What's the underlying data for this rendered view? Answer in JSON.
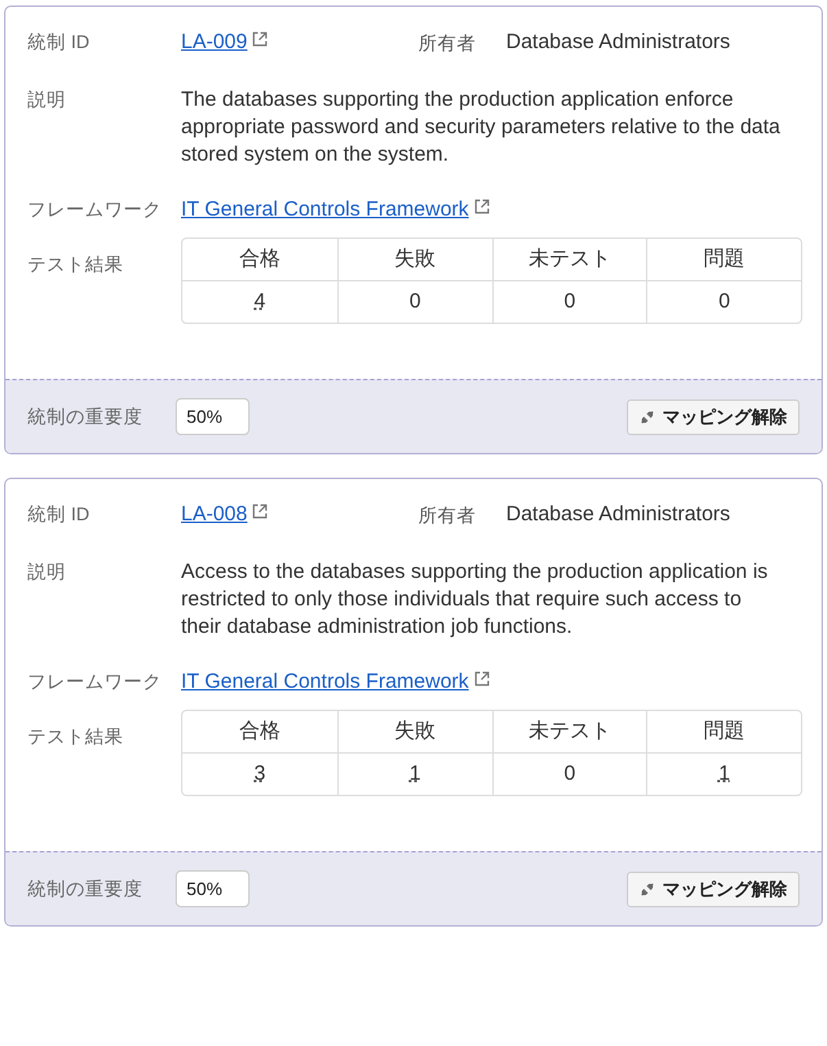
{
  "cards": [
    {
      "id_label": "統制 ID",
      "id": "LA-009",
      "owner_label": "所有者",
      "owner": "Database Administrators",
      "desc_label": "説明",
      "description": "The databases supporting the production application enforce appropriate password and security parameters relative to the data stored system on the system.",
      "framework_label": "フレームワーク",
      "framework": "IT General Controls Framework",
      "results_label": "テスト結果",
      "results": [
        {
          "header": "合格",
          "value": "4",
          "link": true
        },
        {
          "header": "失敗",
          "value": "0",
          "link": false
        },
        {
          "header": "未テスト",
          "value": "0",
          "link": false
        },
        {
          "header": "問題",
          "value": "0",
          "link": false
        }
      ],
      "importance_label": "統制の重要度",
      "importance": "50%",
      "unmap_button": "マッピング解除"
    },
    {
      "id_label": "統制 ID",
      "id": "LA-008",
      "owner_label": "所有者",
      "owner": "Database Administrators",
      "desc_label": "説明",
      "description": "Access to the databases supporting the production application is restricted to only those individuals that require such access to their database administration job functions.",
      "framework_label": "フレームワーク",
      "framework": "IT General Controls Framework",
      "results_label": "テスト結果",
      "results": [
        {
          "header": "合格",
          "value": "3",
          "link": true
        },
        {
          "header": "失敗",
          "value": "1",
          "link": true
        },
        {
          "header": "未テスト",
          "value": "0",
          "link": false
        },
        {
          "header": "問題",
          "value": "1",
          "link": true
        }
      ],
      "importance_label": "統制の重要度",
      "importance": "50%",
      "unmap_button": "マッピング解除"
    }
  ]
}
